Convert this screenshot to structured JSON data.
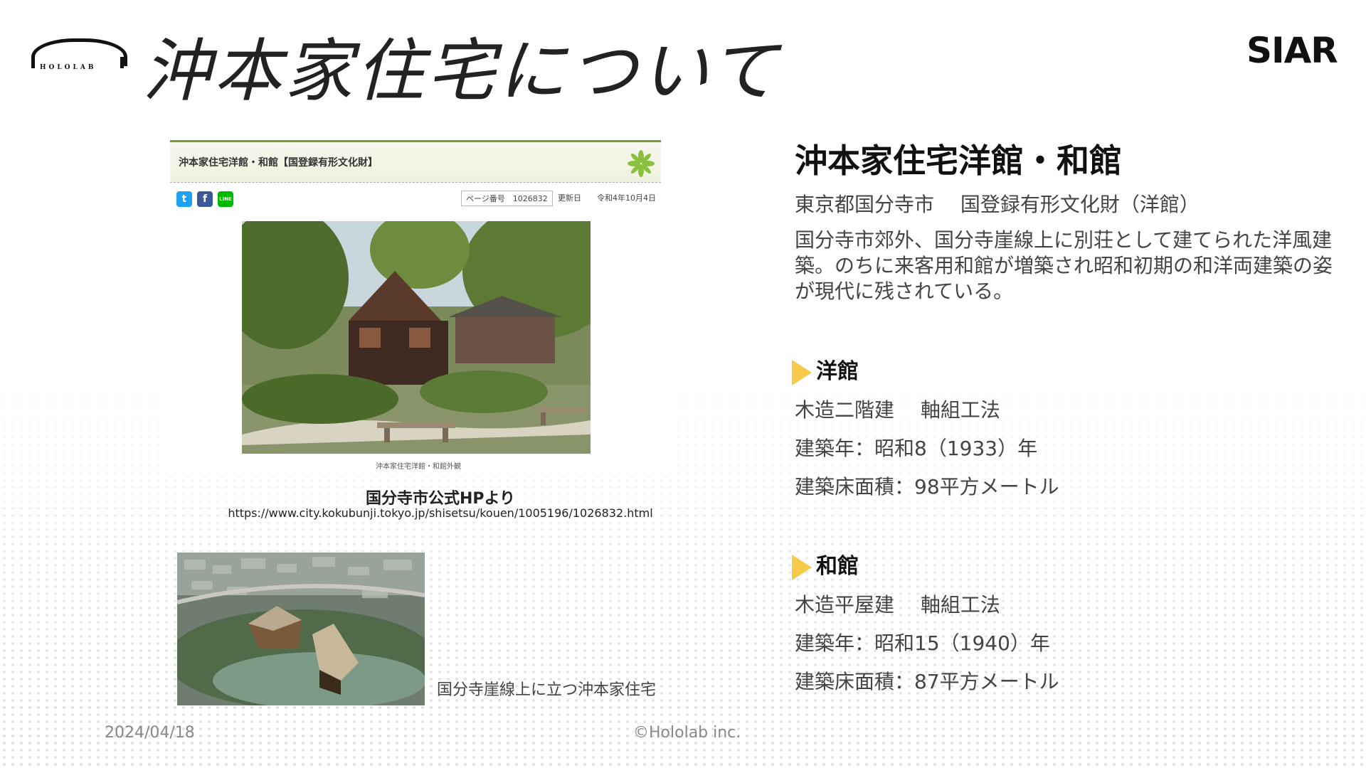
{
  "header": {
    "title": "沖本家住宅について",
    "company_logo_text": "HOLOLAB",
    "partner_logo_text": "SIAR"
  },
  "webpage_card": {
    "page_title": "沖本家住宅洋館・和館【国登録有形文化財】",
    "social": {
      "twitter": "t",
      "facebook": "f",
      "line": "LINE"
    },
    "page_number_label": "ページ番号　1026832",
    "updated_label": "更新日　　令和4年10月4日",
    "photo_caption": "沖本家住宅洋館・和館外観"
  },
  "source": {
    "title": "国分寺市公式HPより",
    "url": "https://www.city.kokubunji.tokyo.jp/shisetsu/kouen/1005196/1026832.html"
  },
  "aerial_caption": "国分寺崖線上に立つ沖本家住宅",
  "footer": {
    "date": "2024/04/18",
    "copyright": "©Hololab inc."
  },
  "info": {
    "heading": "沖本家住宅洋館・和館",
    "subtitle": "東京都国分寺市　 国登録有形文化財（洋館）",
    "description": "国分寺市郊外、国分寺崖線上に別荘として建てられた洋風建築。のちに来客用和館が増築され昭和初期の和洋両建築の姿が現代に残されている。",
    "western": {
      "title": "洋館",
      "structure": "木造二階建　 軸組工法",
      "year": "建築年：昭和8（1933）年",
      "area": "建築床面積：98平方メートル"
    },
    "japanese": {
      "title": "和館",
      "structure": "木造平屋建　 軸組工法",
      "year": "建築年：昭和15（1940）年",
      "area": "建築床面積：87平方メートル"
    }
  },
  "colors": {
    "accent_triangle": "#f7c948",
    "header_green": "#7a9a3a"
  }
}
